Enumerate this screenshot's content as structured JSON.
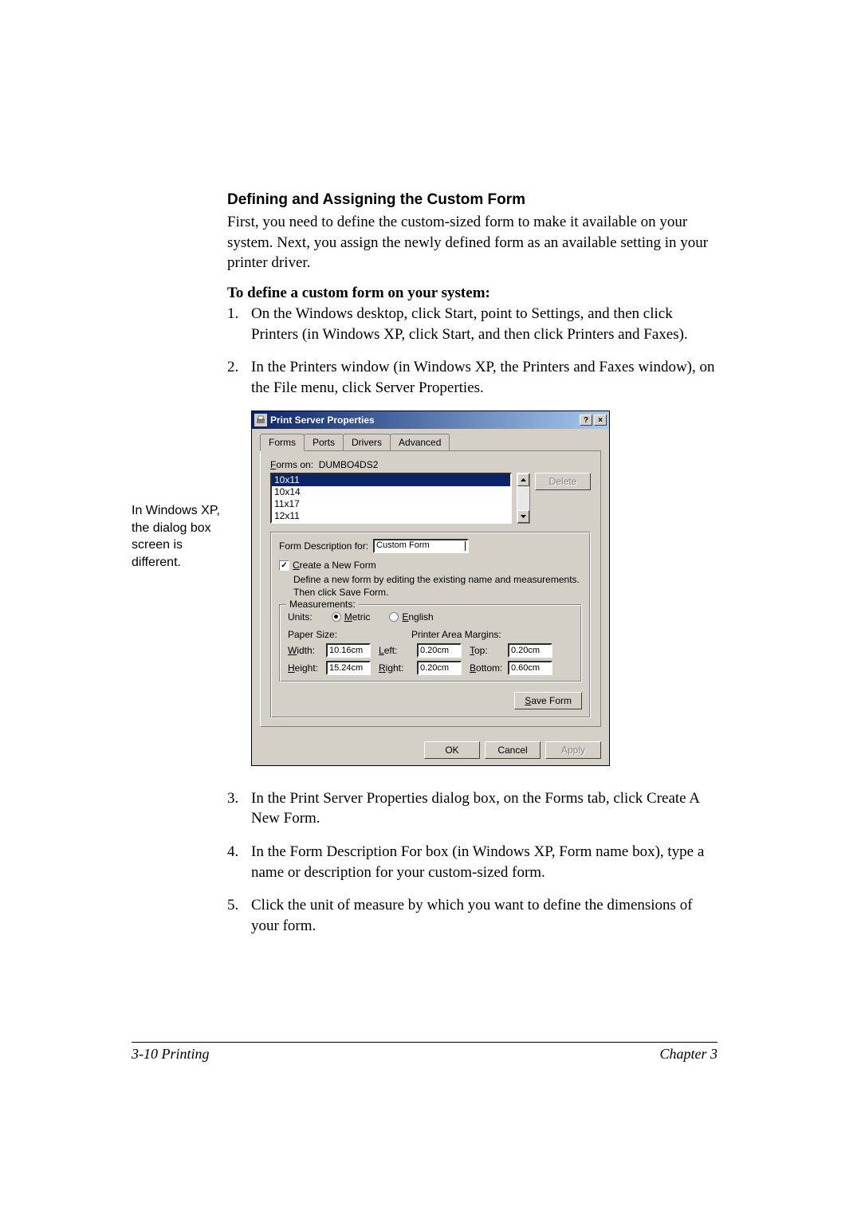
{
  "margin_note": "In Windows XP, the dialog box screen is different.",
  "section_title": "Defining and Assigning the Custom Form",
  "intro": "First, you need to define the custom-sized form to make it available on your system. Next, you assign the newly defined form as an available setting in your printer driver.",
  "lead": "To define a custom form on your system:",
  "steps_top": [
    {
      "n": "1.",
      "t": "On the Windows desktop, click Start, point to Settings, and then click Printers (in Windows XP, click Start, and then click Printers and Faxes)."
    },
    {
      "n": "2.",
      "t": "In the Printers window (in Windows XP, the Printers and Faxes window), on the File menu, click Server Properties."
    }
  ],
  "steps_bottom": [
    {
      "n": "3.",
      "t": "In the Print Server Properties dialog box, on the Forms tab, click Create A New Form."
    },
    {
      "n": "4.",
      "t": "In the Form Description For box (in Windows XP, Form name box), type a name or description for your custom-sized form."
    },
    {
      "n": "5.",
      "t": "Click the unit of measure by which you want to define the dimensions of your form."
    }
  ],
  "dialog": {
    "title": "Print Server Properties",
    "help_btn": "?",
    "close_btn": "×",
    "tabs": [
      "Forms",
      "Ports",
      "Drivers",
      "Advanced"
    ],
    "forms_on_label": "Forms on:",
    "forms_on_value": "DUMBO4DS2",
    "list": [
      "10x11",
      "10x14",
      "11x17",
      "12x11"
    ],
    "delete": "Delete",
    "form_desc_label": "Form Description for:",
    "form_desc_value": "Custom Form",
    "create_label": "Create a New Form",
    "create_hint": "Define a new form by editing the existing name and measurements. Then click Save Form.",
    "measurements": "Measurements:",
    "units_label": "Units:",
    "metric": "Metric",
    "english": "English",
    "paper_size": "Paper Size:",
    "printer_margins": "Printer Area Margins:",
    "width_l": "Width:",
    "width_v": "10.16cm",
    "height_l": "Height:",
    "height_v": "15.24cm",
    "left_l": "Left:",
    "left_v": "0.20cm",
    "right_l": "Right:",
    "right_v": "0.20cm",
    "top_l": "Top:",
    "top_v": "0.20cm",
    "bottom_l": "Bottom:",
    "bottom_v": "0.60cm",
    "save_form": "Save Form",
    "ok": "OK",
    "cancel": "Cancel",
    "apply": "Apply"
  },
  "footer": {
    "left": "3-10   Printing",
    "right": "Chapter 3"
  }
}
